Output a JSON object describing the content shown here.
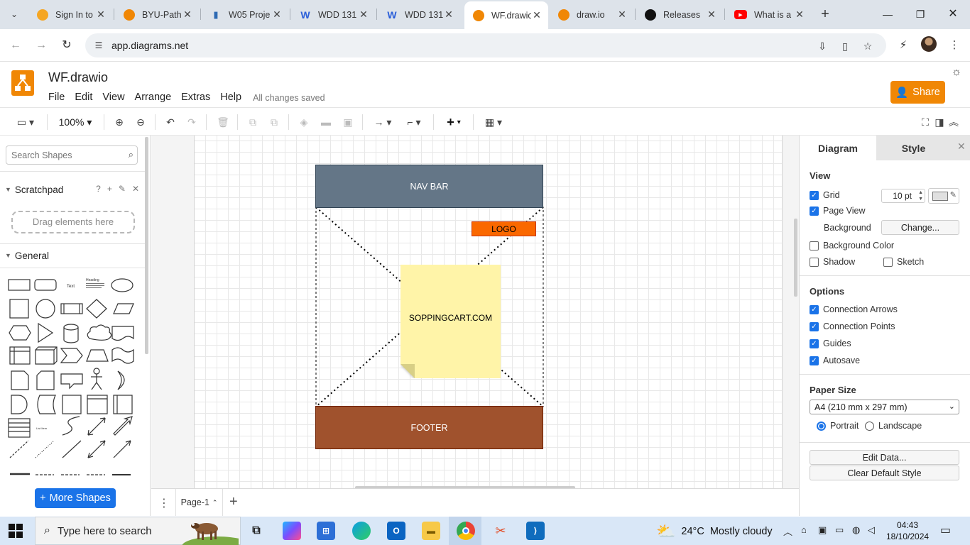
{
  "browser": {
    "tabs": [
      {
        "title": "Sign In to",
        "favicon_color": "#f5a623"
      },
      {
        "title": "BYU-Path",
        "favicon_color": "#f08705"
      },
      {
        "title": "W05 Proje",
        "favicon_color": "#2d6ab3"
      },
      {
        "title": "WDD 131",
        "favicon_color": "#2b5fd9"
      },
      {
        "title": "WDD 131",
        "favicon_color": "#2b5fd9"
      },
      {
        "title": "WF.drawio",
        "favicon_color": "#f08705"
      },
      {
        "title": "draw.io",
        "favicon_color": "#f08705"
      },
      {
        "title": "Releases",
        "favicon_color": "#111111"
      },
      {
        "title": "What is a",
        "favicon_color": "#ff0000"
      }
    ],
    "active_tab_index": 5,
    "url": "app.diagrams.net"
  },
  "app": {
    "filename": "WF.drawio",
    "menu": [
      "File",
      "Edit",
      "View",
      "Arrange",
      "Extras",
      "Help"
    ],
    "save_status": "All changes saved",
    "share_label": "Share",
    "brand_color": "#f08705"
  },
  "toolbar": {
    "zoom": "100%"
  },
  "left_panel": {
    "search_placeholder": "Search Shapes",
    "scratchpad_title": "Scratchpad",
    "dropzone_text": "Drag elements here",
    "general_title": "General",
    "more_shapes_label": "More Shapes"
  },
  "diagram": {
    "navbar_label": "NAV BAR",
    "navbar_color": "#647687",
    "logo_label": "LOGO",
    "logo_color": "#fa6800",
    "note_label": "SOPPINGCART.COM",
    "note_color": "#fff4a8",
    "footer_label": "FOOTER",
    "footer_color": "#a0522d"
  },
  "pages": {
    "current": "Page-1"
  },
  "format_panel": {
    "tabs": [
      "Diagram",
      "Style"
    ],
    "view_title": "View",
    "grid_label": "Grid",
    "grid_size": "10 pt",
    "page_view_label": "Page View",
    "background_label": "Background",
    "change_label": "Change...",
    "background_color_label": "Background Color",
    "shadow_label": "Shadow",
    "sketch_label": "Sketch",
    "options_title": "Options",
    "options": [
      "Connection Arrows",
      "Connection Points",
      "Guides",
      "Autosave"
    ],
    "paper_size_title": "Paper Size",
    "paper_size_value": "A4 (210 mm x 297 mm)",
    "portrait_label": "Portrait",
    "landscape_label": "Landscape",
    "edit_data_label": "Edit Data...",
    "clear_style_label": "Clear Default Style"
  },
  "taskbar": {
    "search_placeholder": "Type here to search",
    "weather_temp": "24°C",
    "weather_text": "Mostly cloudy",
    "time": "04:43",
    "date": "18/10/2024"
  }
}
